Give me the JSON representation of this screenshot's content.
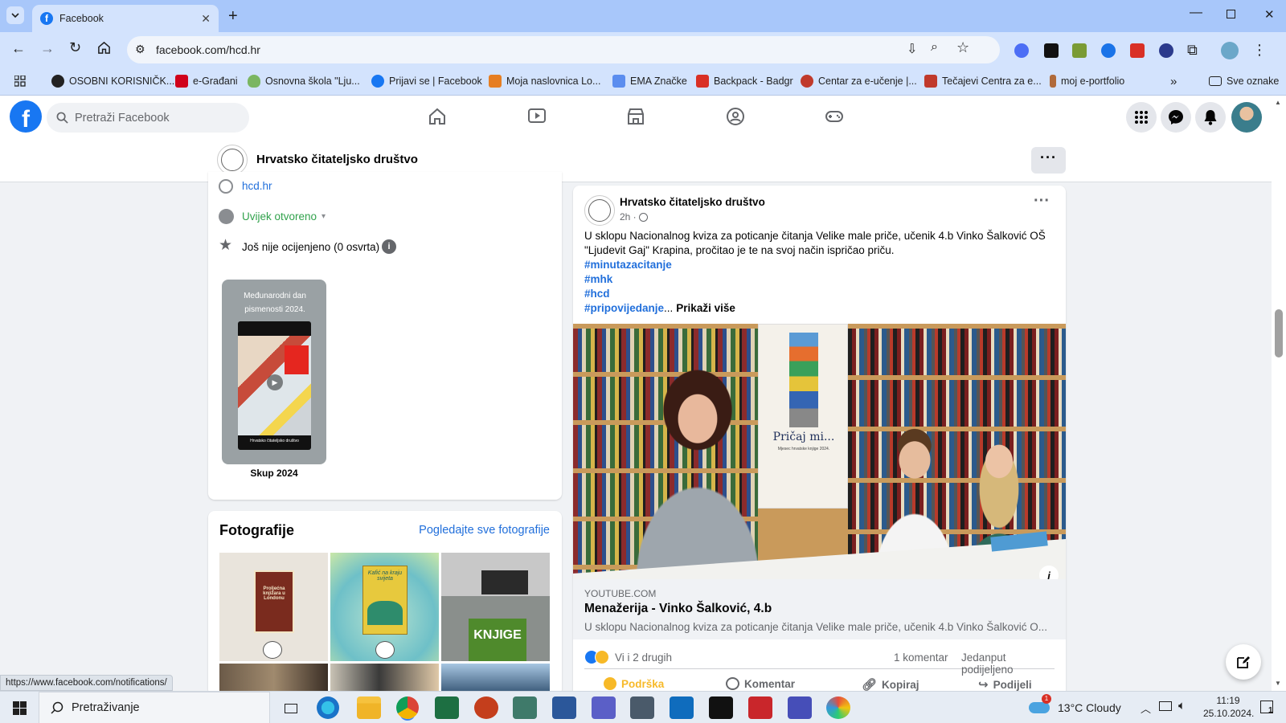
{
  "browser": {
    "tab_title": "Facebook",
    "url": "facebook.com/hcd.hr",
    "bookmarks": [
      {
        "label": "OSOBNI KORISNIČK...",
        "color": "#222222"
      },
      {
        "label": "e-Građani",
        "color": "#d0021b"
      },
      {
        "label": "Osnovna škola \"Lju...",
        "color": "#7bb661"
      },
      {
        "label": "Prijavi se | Facebook",
        "color": "#1877f2"
      },
      {
        "label": "Moja naslovnica Lo...",
        "color": "#e67e22"
      },
      {
        "label": "EMA Značke",
        "color": "#5b8def"
      },
      {
        "label": "Backpack - Badgr",
        "color": "#d93025"
      },
      {
        "label": "Centar za e-učenje |...",
        "color": "#c0392b"
      },
      {
        "label": "Tečajevi Centra za e...",
        "color": "#c0392b"
      },
      {
        "label": "moj e-portfolio",
        "color": "#b06a3b"
      }
    ],
    "all_bookmarks": "Sve oznake",
    "status_url": "https://www.facebook.com/notifications/"
  },
  "fb": {
    "search_placeholder": "Pretraži Facebook",
    "page_name": "Hrvatsko čitateljsko društvo",
    "website": "hcd.hr",
    "hours": "Uvijek otvoreno",
    "rating": "Još nije ocijenjeno (0 osvrta)",
    "reel": {
      "title_overlay": "Međunarodni dan pismenosti 2024.",
      "card_brand": "Hrvatsko čitateljsko društvo",
      "label": "Skup 2024"
    },
    "photos": {
      "title": "Fotografije",
      "see_all": "Pogledajte sve fotografije",
      "tiles": [
        {
          "caption": "Proljećna knjižara u Londonu",
          "bg": "#e9e4dc",
          "accent": "#7a2b1e"
        },
        {
          "caption": "Kafić na kraju svijeta",
          "bg": "#6ec0c8",
          "accent": "#e7c93d"
        },
        {
          "caption": "KNJIGE",
          "bg": "#8a8f8c",
          "accent": "#4f8a2c"
        },
        {
          "caption": "",
          "bg": "#6b5a48",
          "accent": "#3b2f26"
        },
        {
          "caption": "",
          "bg": "#c9c3b5",
          "accent": "#3a3a3a"
        },
        {
          "caption": "",
          "bg": "#a7c6e2",
          "accent": "#2f4f6e"
        }
      ]
    },
    "post": {
      "author": "Hrvatsko čitateljsko društvo",
      "time": "2h ·",
      "text": "U sklopu Nacionalnog kviza za poticanje čitanja Velike male priče, učenik 4.b Vinko Šalković OŠ \"Ljudevit Gaj\" Krapina, pročitao je te na svoj način ispričao priču.",
      "hashtags": [
        "#minutazacitanje",
        "#mhk",
        "#hcd"
      ],
      "last_hashtag": "#pripovijedanje",
      "ellipsis": "...",
      "see_more": "Prikaži više",
      "poster_title": "Pričaj mi...",
      "poster_sub": "Mjesec hrvatske knjige 2024.",
      "link_domain": "YOUTUBE.COM",
      "link_title": "Menažerija - Vinko Šalković, 4.b",
      "link_desc": "U sklopu Nacionalnog kviza za poticanje čitanja Velike male priče, učenik 4.b Vinko Šalković O...",
      "reactions": "Vi i 2 drugih",
      "comments": "1 komentar",
      "shares": "Jedanput podijeljeno",
      "actions": {
        "support": "Podrška",
        "comment": "Komentar",
        "copy": "Kopiraj",
        "share": "Podijeli"
      }
    }
  },
  "taskbar": {
    "search_placeholder": "Pretraživanje",
    "weather": "13°C Cloudy",
    "weather_badge": "1",
    "time": "11:19",
    "date": "25.10.2024.",
    "notif_count": "1"
  }
}
